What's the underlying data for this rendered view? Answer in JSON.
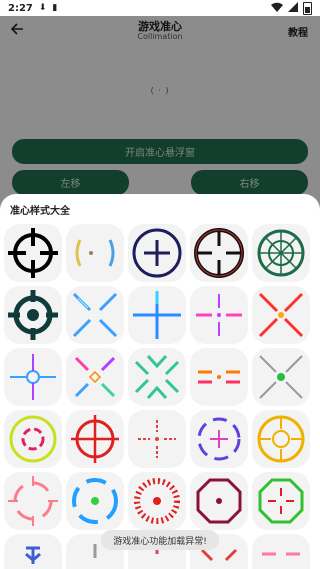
{
  "status_bar": {
    "time": "2:27"
  },
  "app_bar": {
    "title": "游戏准心",
    "subtitle": "Collimation",
    "tutorial_label": "教程"
  },
  "preview": {
    "text": "( · )"
  },
  "buttons": {
    "enable_overlay": "开启准心悬浮窗",
    "move_left": "左移",
    "move_right": "右移"
  },
  "sheet": {
    "title": "准心样式大全"
  },
  "toast": "游戏准心功能加载异常!"
}
